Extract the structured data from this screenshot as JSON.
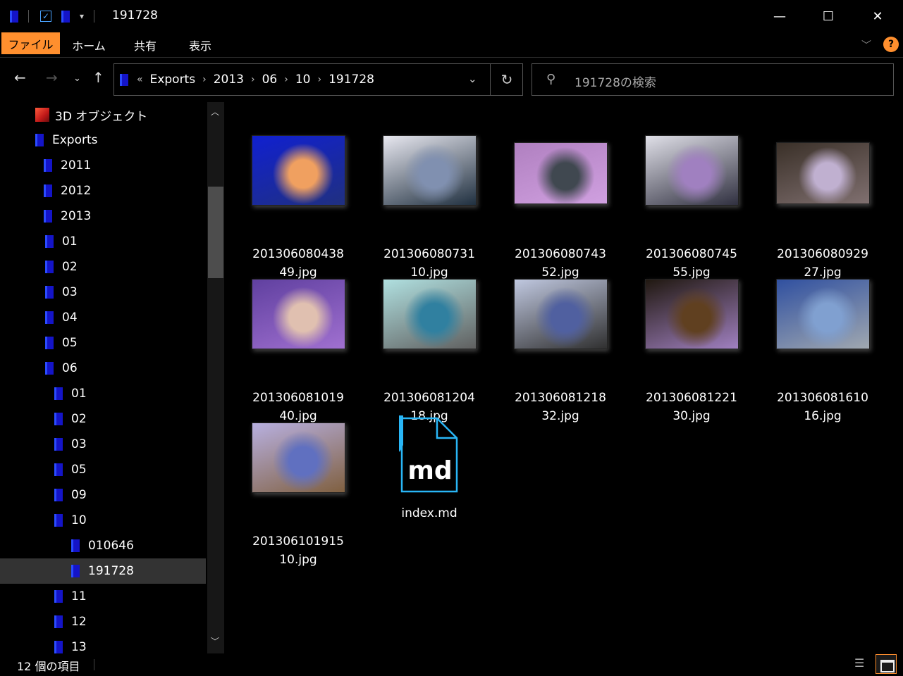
{
  "window": {
    "title": "191728"
  },
  "ribbon": {
    "tabs": [
      "ファイル",
      "ホーム",
      "共有",
      "表示"
    ],
    "help_label": "?"
  },
  "address": {
    "overflow": "«",
    "crumbs": [
      "Exports",
      "2013",
      "06",
      "10",
      "191728"
    ]
  },
  "search": {
    "placeholder": "191728の検索"
  },
  "nav": {
    "items": [
      {
        "label": "3D オブジェクト",
        "level": 0,
        "icon": "3d-objects-icon"
      },
      {
        "label": "Exports",
        "level": 0,
        "icon": "folder-icon"
      },
      {
        "label": "2011",
        "level": 1,
        "icon": "folder-icon"
      },
      {
        "label": "2012",
        "level": 1,
        "icon": "folder-icon"
      },
      {
        "label": "2013",
        "level": 1,
        "icon": "folder-icon"
      },
      {
        "label": "01",
        "level": 2,
        "icon": "folder-icon"
      },
      {
        "label": "02",
        "level": 2,
        "icon": "folder-icon"
      },
      {
        "label": "03",
        "level": 2,
        "icon": "folder-icon"
      },
      {
        "label": "04",
        "level": 2,
        "icon": "folder-icon"
      },
      {
        "label": "05",
        "level": 2,
        "icon": "folder-icon"
      },
      {
        "label": "06",
        "level": 2,
        "icon": "folder-icon"
      },
      {
        "label": "01",
        "level": 3,
        "icon": "folder-icon"
      },
      {
        "label": "02",
        "level": 3,
        "icon": "folder-icon"
      },
      {
        "label": "03",
        "level": 3,
        "icon": "folder-icon"
      },
      {
        "label": "05",
        "level": 3,
        "icon": "folder-icon"
      },
      {
        "label": "09",
        "level": 3,
        "icon": "folder-icon"
      },
      {
        "label": "10",
        "level": 3,
        "icon": "folder-icon"
      },
      {
        "label": "010646",
        "level": 4,
        "icon": "folder-icon"
      },
      {
        "label": "191728",
        "level": 4,
        "icon": "folder-icon",
        "selected": true
      },
      {
        "label": "11",
        "level": 3,
        "icon": "folder-icon"
      },
      {
        "label": "12",
        "level": 3,
        "icon": "folder-icon"
      },
      {
        "label": "13",
        "level": 3,
        "icon": "folder-icon"
      }
    ]
  },
  "files": [
    {
      "name": "20130608043849.jpg",
      "type": "image",
      "palette": [
        "#1020d0",
        "#f0a060",
        "#203080"
      ]
    },
    {
      "name": "20130608073110.jpg",
      "type": "image",
      "palette": [
        "#e8e8f0",
        "#8090b0",
        "#203040"
      ]
    },
    {
      "name": "20130608074352.jpg",
      "type": "image",
      "palette": [
        "#b080c0",
        "#404850",
        "#d0a0e0"
      ]
    },
    {
      "name": "20130608074555.jpg",
      "type": "image",
      "palette": [
        "#e0e0e8",
        "#a080c0",
        "#303040"
      ]
    },
    {
      "name": "20130608092927.jpg",
      "type": "image",
      "palette": [
        "#3a3028",
        "#c0b0d0",
        "#807070"
      ]
    },
    {
      "name": "20130608101940.jpg",
      "type": "image",
      "palette": [
        "#6040a0",
        "#e0c0b0",
        "#a070d0"
      ]
    },
    {
      "name": "20130608120418.jpg",
      "type": "image",
      "palette": [
        "#b0e0e0",
        "#3080a0",
        "#606060"
      ]
    },
    {
      "name": "20130608121832.jpg",
      "type": "image",
      "palette": [
        "#c0c8e0",
        "#5060a0",
        "#303030"
      ]
    },
    {
      "name": "20130608122130.jpg",
      "type": "image",
      "palette": [
        "#201810",
        "#604020",
        "#a080c0"
      ]
    },
    {
      "name": "20130608161016.jpg",
      "type": "image",
      "palette": [
        "#3050a0",
        "#80a0d0",
        "#a0a8b0"
      ]
    },
    {
      "name": "20130610191510.jpg",
      "type": "image",
      "palette": [
        "#b8b0e0",
        "#6070c0",
        "#806040"
      ]
    },
    {
      "name": "index.md",
      "type": "markdown"
    }
  ],
  "md_icon_text": "md",
  "status": {
    "count_text": "12 個の項目"
  },
  "colors": {
    "accent": "#ff8f2e",
    "folder": "#1414c8",
    "md_icon": "#29b6f6"
  }
}
